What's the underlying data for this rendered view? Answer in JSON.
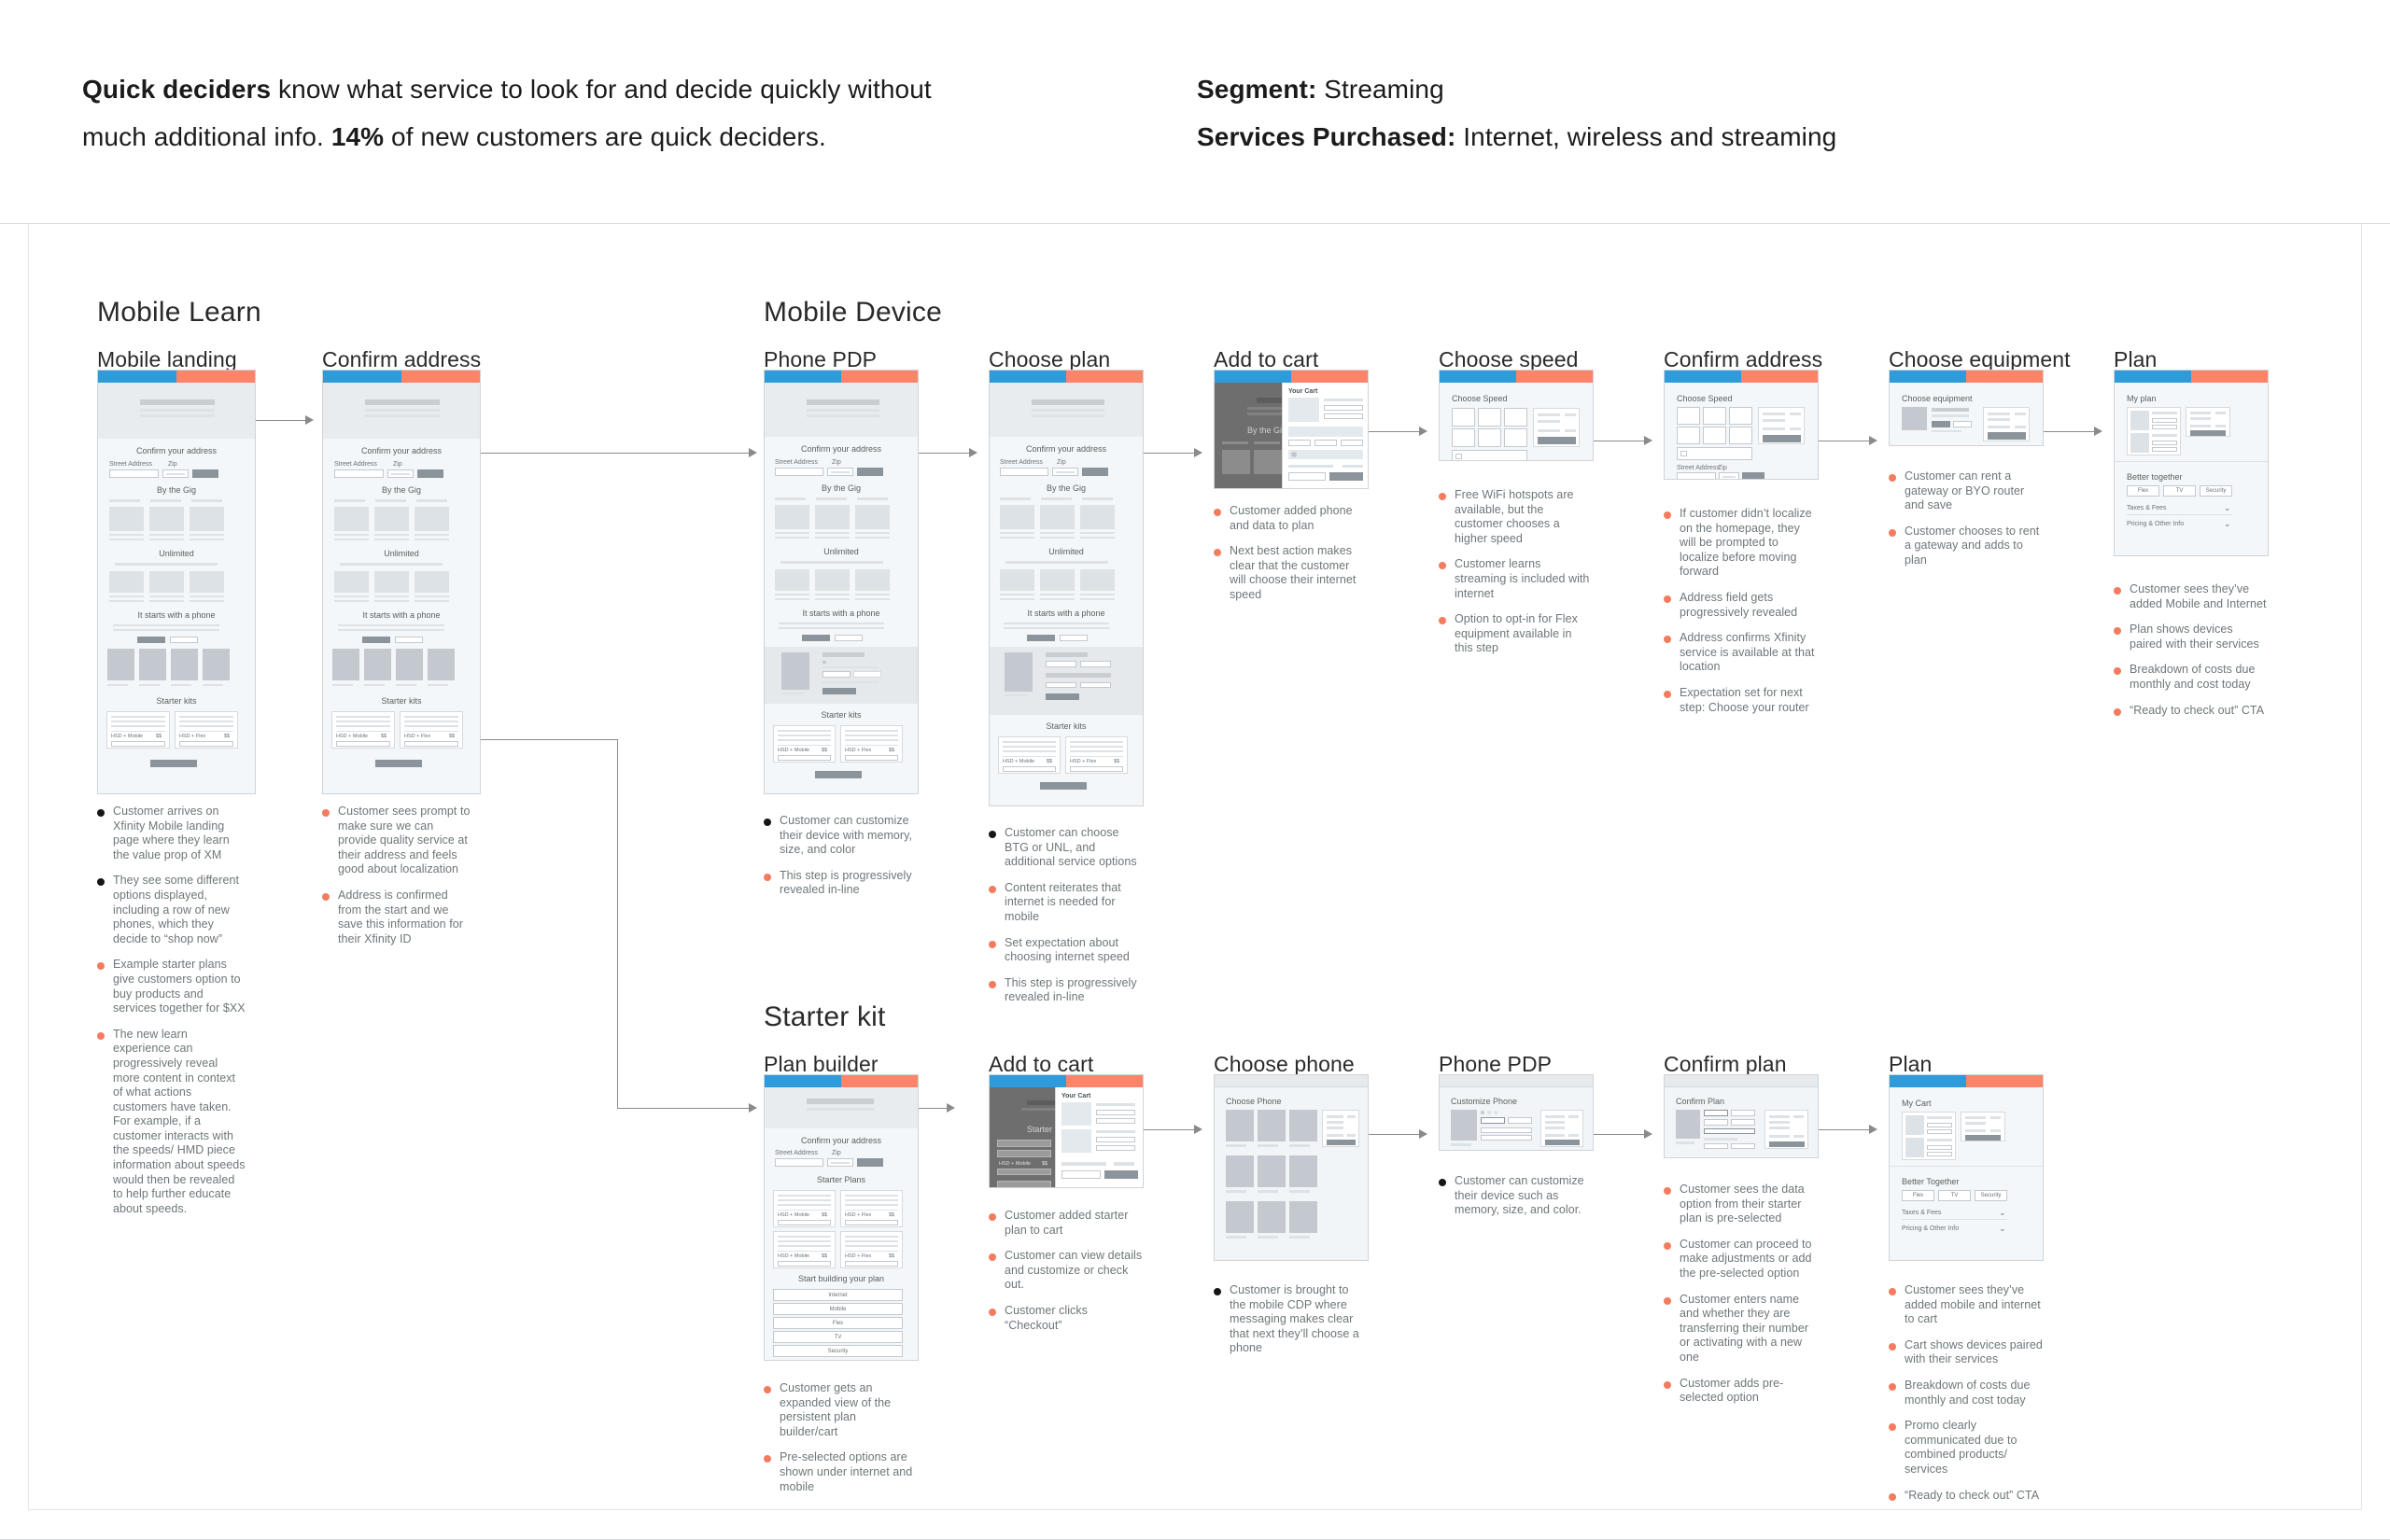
{
  "header": {
    "line1_bold": "Quick deciders",
    "line1_rest": " know what service to look for and decide quickly without",
    "line2_rest_a": "much additional info. ",
    "line2_bold": "14%",
    "line2_rest_b": " of new customers are quick deciders.",
    "segment_label": "Segment:",
    "segment_value": " Streaming",
    "services_label": "Services Purchased:",
    "services_value": " Internet, wireless and streaming"
  },
  "colors": {
    "blue": "#2E9BDB",
    "orange": "#FB8469",
    "bullet_orange": "#F47B5E",
    "bullet_black": "#161616"
  },
  "sections": {
    "mobile_learn": "Mobile Learn",
    "mobile_device": "Mobile Device",
    "starter_kit": "Starter kit"
  },
  "wireframe_text": {
    "confirm_address": "Confirm your address",
    "street_address": "Street Address",
    "zip": "Zip",
    "by_the_gig": "By the Gig",
    "unlimited": "Unlimited",
    "starts_with_phone": "It starts with a phone",
    "starter_kits": "Starter kits",
    "starter_plans": "Starter Plans",
    "start_building": "Start building your plan",
    "hsd_mobile": "HSD + Mobile",
    "hsd_flex": "HSD + Flex",
    "price": "$$",
    "your_cart": "Your Cart",
    "choose_speed": "Choose Speed",
    "choose_equipment": "Choose equipment",
    "choose_phone": "Choose Phone",
    "customize_phone": "Customize Phone",
    "confirm_plan": "Confirm Plan",
    "my_plan": "My plan",
    "my_cart": "My Cart",
    "better_together": "Better together",
    "better_together_cap": "Better Together",
    "taxes_fees": "Taxes & Fees",
    "pricing_other": "Pricing & Other Info",
    "chip_flex": "Flex",
    "chip_tv": "TV",
    "chip_security": "Security",
    "nav_internet": "Internet",
    "nav_mobile": "Mobile",
    "nav_flex": "Flex",
    "nav_tv": "TV",
    "nav_security": "Security"
  },
  "steps": [
    {
      "id": "mobile-landing",
      "title": "Mobile landing",
      "notes": [
        {
          "color": "black",
          "text": "Customer arrives on Xfinity Mobile landing page where they learn the value prop of XM"
        },
        {
          "color": "black",
          "text": "They see some different options displayed, including a row of new phones, which they decide to “shop now”"
        },
        {
          "color": "orange",
          "text": "Example starter plans give customers option to buy products and services together for $XX"
        },
        {
          "color": "orange",
          "text": "The new learn experience can progressively reveal more content in context of what actions customers have taken. For example, if a customer interacts with the speeds/ HMD piece information about speeds would then be revealed to help further educate about speeds."
        }
      ]
    },
    {
      "id": "confirm-address-learn",
      "title": "Confirm address",
      "notes": [
        {
          "color": "orange",
          "text": "Customer sees prompt to make sure we can provide quality service at their address and feels good about localization"
        },
        {
          "color": "orange",
          "text": "Address is confirmed from the start and we save this information for their Xfinity ID"
        }
      ]
    },
    {
      "id": "phone-pdp",
      "title": "Phone PDP",
      "notes": [
        {
          "color": "black",
          "text": "Customer can customize their device with memory, size, and color"
        },
        {
          "color": "orange",
          "text": "This step is progressively revealed in-line"
        }
      ]
    },
    {
      "id": "choose-plan",
      "title": "Choose plan",
      "notes": [
        {
          "color": "black",
          "text": "Customer can choose BTG or UNL, and additional service options"
        },
        {
          "color": "orange",
          "text": "Content reiterates that internet is needed for mobile"
        },
        {
          "color": "orange",
          "text": "Set expectation about choosing internet speed"
        },
        {
          "color": "orange",
          "text": "This step is progressively revealed in-line"
        }
      ]
    },
    {
      "id": "add-to-cart-top",
      "title": "Add to cart",
      "notes": [
        {
          "color": "orange",
          "text": "Customer added phone and data to plan"
        },
        {
          "color": "orange",
          "text": "Next best action makes clear that the customer will choose their internet speed"
        }
      ]
    },
    {
      "id": "choose-speed",
      "title": "Choose speed",
      "notes": [
        {
          "color": "orange",
          "text": "Free WiFi hotspots are available, but the customer chooses a higher speed"
        },
        {
          "color": "orange",
          "text": "Customer learns streaming is included with internet"
        },
        {
          "color": "orange",
          "text": "Option to opt-in for Flex equipment available in this step"
        }
      ]
    },
    {
      "id": "confirm-address-device",
      "title": "Confirm address",
      "notes": [
        {
          "color": "orange",
          "text": "If customer didn’t localize on the homepage, they will be prompted to localize before moving forward"
        },
        {
          "color": "orange",
          "text": "Address field gets progressively revealed"
        },
        {
          "color": "orange",
          "text": "Address confirms Xfinity service is available at that location"
        },
        {
          "color": "orange",
          "text": "Expectation set for next step: Choose your router"
        }
      ]
    },
    {
      "id": "choose-equipment",
      "title": "Choose equipment",
      "notes": [
        {
          "color": "orange",
          "text": "Customer can rent a gateway or BYO router and save"
        },
        {
          "color": "orange",
          "text": "Customer chooses to rent a gateway and adds to plan"
        }
      ]
    },
    {
      "id": "plan-top",
      "title": "Plan",
      "notes": [
        {
          "color": "orange",
          "text": "Customer sees they’ve added Mobile and Internet"
        },
        {
          "color": "orange",
          "text": "Plan shows devices paired with their services"
        },
        {
          "color": "orange",
          "text": "Breakdown of costs due monthly and cost today"
        },
        {
          "color": "orange",
          "text": "“Ready to check out” CTA"
        }
      ]
    },
    {
      "id": "plan-builder",
      "title": "Plan builder",
      "notes": [
        {
          "color": "orange",
          "text": "Customer gets an expanded view of the persistent plan builder/cart"
        },
        {
          "color": "orange",
          "text": "Pre-selected options are shown under internet and mobile"
        }
      ]
    },
    {
      "id": "add-to-cart-bottom",
      "title": "Add to cart",
      "notes": [
        {
          "color": "orange",
          "text": "Customer added starter plan to cart"
        },
        {
          "color": "orange",
          "text": "Customer can view details and customize or check out."
        },
        {
          "color": "orange",
          "text": "Customer clicks  “Checkout”"
        }
      ]
    },
    {
      "id": "choose-phone",
      "title": "Choose phone",
      "notes": [
        {
          "color": "black",
          "text": "Customer is brought to the mobile CDP where messaging makes clear that next they’ll choose a phone"
        }
      ]
    },
    {
      "id": "phone-pdp-bottom",
      "title": "Phone PDP",
      "notes": [
        {
          "color": "black",
          "text": "Customer can customize their device such as memory, size, and color."
        }
      ]
    },
    {
      "id": "confirm-plan",
      "title": "Confirm plan",
      "notes": [
        {
          "color": "orange",
          "text": "Customer sees the data option from their starter plan is pre-selected"
        },
        {
          "color": "orange",
          "text": "Customer can proceed to make adjustments or add the pre-selected option"
        },
        {
          "color": "orange",
          "text": "Customer enters name and whether they are transferring their number or activating with a new one"
        },
        {
          "color": "orange",
          "text": "Customer adds pre-selected option"
        }
      ]
    },
    {
      "id": "plan-bottom",
      "title": "Plan",
      "notes": [
        {
          "color": "orange",
          "text": "Customer sees they’ve added mobile and internet to cart"
        },
        {
          "color": "orange",
          "text": "Cart shows devices paired with their services"
        },
        {
          "color": "orange",
          "text": "Breakdown of costs due monthly and cost today"
        },
        {
          "color": "orange",
          "text": "Promo clearly communicated due to combined products/ services"
        },
        {
          "color": "orange",
          "text": "“Ready to check out” CTA"
        }
      ]
    }
  ]
}
